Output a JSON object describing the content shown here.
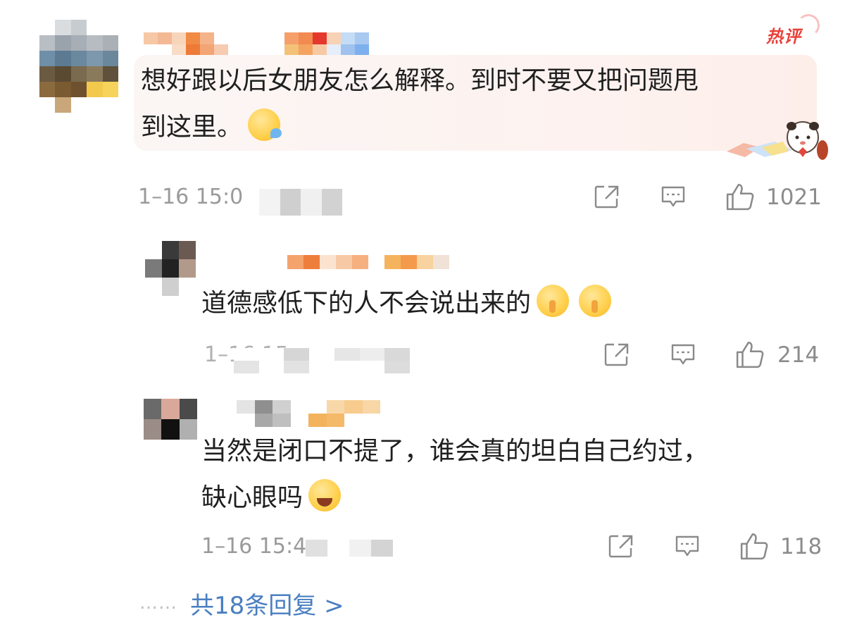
{
  "hot_badge": "热评",
  "main_comment": {
    "text_line1": "想好跟以后女朋友怎么解释。到时不要又把问题甩",
    "text_line2": "到这里。",
    "emoji": "sleepy-face-emoji",
    "time": "1–16 15:0",
    "likes": "1021"
  },
  "replies": [
    {
      "text": "道德感低下的人不会说出来的",
      "emoji": "shushing-face-emoji",
      "time": "1–16 15",
      "likes": "214"
    },
    {
      "text_line1": "当然是闭口不提了，谁会真的坦白自己约过，",
      "text_line2": "缺心眼吗",
      "emoji": "laughing-tears-emoji",
      "time": "1–16 15:4",
      "likes": "118"
    }
  ],
  "more_replies": {
    "dots": "……",
    "label": "共18条回复 >"
  },
  "icons": [
    "share-icon",
    "comment-icon",
    "like-icon"
  ],
  "colors": {
    "accent_link": "#4a7fc1",
    "hot_red": "#e8413a",
    "meta_gray": "#9a9a9a"
  }
}
